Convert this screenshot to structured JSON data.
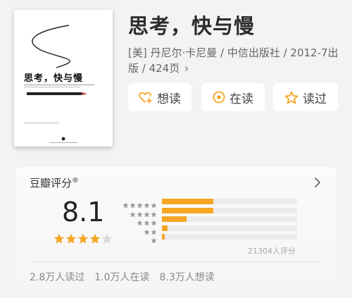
{
  "book": {
    "title": "思考，快与慢",
    "meta": "[美] 丹尼尔·卡尼曼 / 中信出版社 / 2012-7出版 / 424页",
    "meta_chevron": "›",
    "cover_title": "思考，快与慢"
  },
  "actions": {
    "want": "想读",
    "doing": "在读",
    "done": "读过"
  },
  "rating": {
    "title": "豆瓣评分",
    "reg_mark": "®",
    "score": "8.1",
    "stars_filled": 4,
    "stars_total": 5,
    "count_label": "21304人评分",
    "distribution": [
      {
        "stars": 5,
        "fraction": 0.38
      },
      {
        "stars": 4,
        "fraction": 0.38
      },
      {
        "stars": 3,
        "fraction": 0.18
      },
      {
        "stars": 2,
        "fraction": 0.04
      },
      {
        "stars": 1,
        "fraction": 0.02
      }
    ],
    "stats": {
      "done": "2.8万人读过",
      "doing": "1.0万人在读",
      "want": "8.3万人想读"
    }
  },
  "colors": {
    "accent": "#f5a623",
    "star_empty": "#d8d8d8",
    "dist_star": "#9b9b9b"
  },
  "icons": {
    "want": "heart-plus-icon",
    "doing": "target-icon",
    "done": "star-outline-icon",
    "card_chevron": "chevron-right-icon"
  }
}
